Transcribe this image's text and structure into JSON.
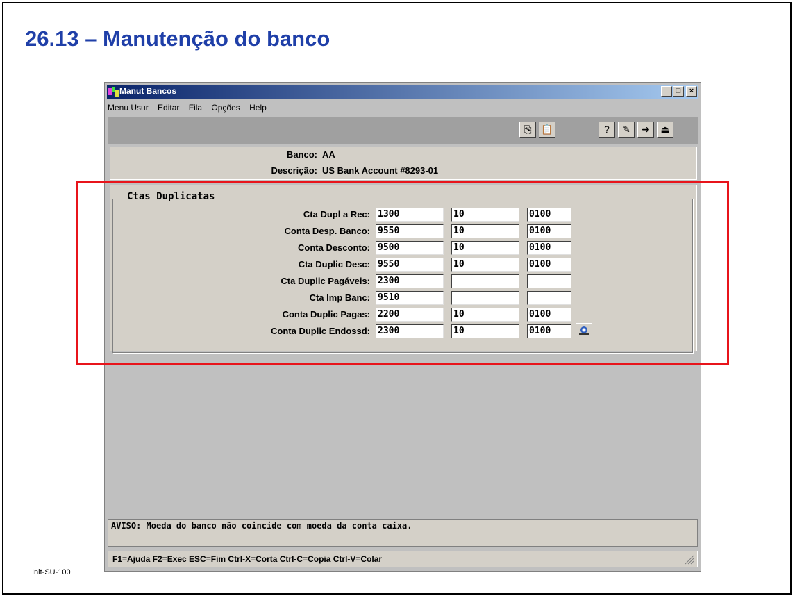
{
  "slide": {
    "title": "26.13 – Manutenção do banco",
    "footer_id": "Init-SU-100"
  },
  "window": {
    "title": "Manut Bancos",
    "controls": [
      "minimize-icon",
      "maximize-icon",
      "close-icon"
    ]
  },
  "menu": [
    {
      "label": "Menu Usur"
    },
    {
      "label": "Editar"
    },
    {
      "label": "Fila"
    },
    {
      "label": "Opções"
    },
    {
      "label": "Help"
    }
  ],
  "toolbar": {
    "icons": [
      "copy-icon",
      "paste-icon",
      "help-context-icon",
      "help-edit-icon",
      "next-record-icon",
      "exit-icon"
    ]
  },
  "header": {
    "banco_label": "Banco:",
    "banco_value": "AA",
    "descricao_label": "Descrição:",
    "descricao_value": "US Bank Account #8293-01"
  },
  "group": {
    "title": "Ctas Duplicatas",
    "rows": [
      {
        "label": "Cta Dupl a Rec:",
        "account": "1300",
        "sub": "10",
        "cc": "0100"
      },
      {
        "label": "Conta Desp. Banco:",
        "account": "9550",
        "sub": "10",
        "cc": "0100"
      },
      {
        "label": "Conta Desconto:",
        "account": "9500",
        "sub": "10",
        "cc": "0100"
      },
      {
        "label": "Cta Duplic Desc:",
        "account": "9550",
        "sub": "10",
        "cc": "0100"
      },
      {
        "label": "Cta Duplic Pagáveis:",
        "account": "2300",
        "sub": "",
        "cc": ""
      },
      {
        "label": "Cta Imp Banc:",
        "account": "9510",
        "sub": "",
        "cc": ""
      },
      {
        "label": "Conta Duplic Pagas:",
        "account": "2200",
        "sub": "10",
        "cc": "0100"
      },
      {
        "label": "Conta Duplic Endossd:",
        "account": "2300",
        "sub": "10",
        "cc": "0100"
      }
    ],
    "lookup_icon": "lookup-icon"
  },
  "warning": "AVISO: Moeda do banco não coincide com moeda da conta caixa.",
  "statusbar": "F1=Ajuda F2=Exec ESC=Fim Ctrl-X=Corta Ctrl-C=Copia Ctrl-V=Colar",
  "colors": {
    "title_blue": "#1f3fa8",
    "highlight_red": "#e8141b",
    "titlebar_start": "#0a246a",
    "titlebar_end": "#a6caf0"
  }
}
